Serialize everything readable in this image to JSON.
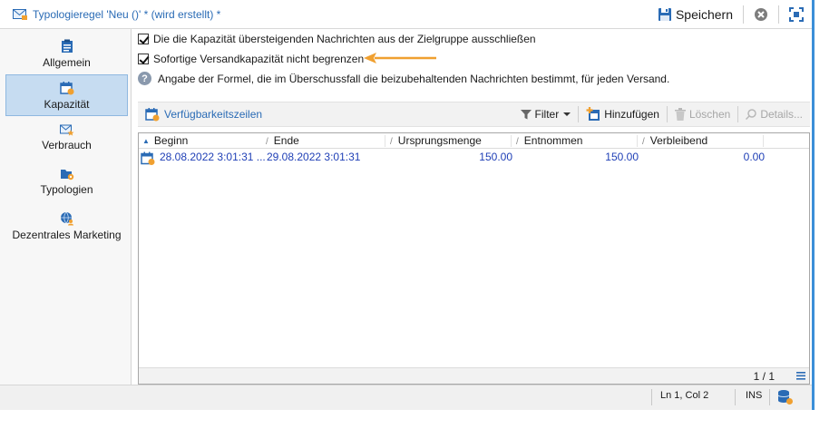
{
  "window": {
    "title": "Typologieregel 'Neu ()' * (wird erstellt) *",
    "save_label": "Speichern"
  },
  "sidebar": {
    "items": [
      {
        "label": "Allgemein",
        "icon": "clipboard-icon",
        "active": false
      },
      {
        "label": "Kapazität",
        "icon": "calendar-capacity-icon",
        "active": true
      },
      {
        "label": "Verbrauch",
        "icon": "envelope-star-icon",
        "active": false
      },
      {
        "label": "Typologien",
        "icon": "folder-gear-icon",
        "active": false
      },
      {
        "label": "Dezentrales Marketing",
        "icon": "globe-people-icon",
        "active": false
      }
    ]
  },
  "main": {
    "option_exclude": "Die die Kapazität übersteigenden Nachrichten aus der Zielgruppe ausschließen",
    "option_unlimited": "Sofortige Versandkapazität nicht begrenzen",
    "info_text": "Angabe der Formel, die im Überschussfall die beizubehaltenden Nachrichten bestimmt, für jeden Versand.",
    "grid_title": "Verfügbarkeitszeilen",
    "toolbar": {
      "filter": "Filter",
      "add": "Hinzufügen",
      "delete": "Löschen",
      "details": "Details..."
    },
    "columns": [
      "Beginn",
      "Ende",
      "Ursprungsmenge",
      "Entnommen",
      "Verbleibend"
    ],
    "rows": [
      {
        "beginn": "28.08.2022 3:01:31 ...",
        "ende": "29.08.2022 3:01:31",
        "ursprungsmenge": "150.00",
        "entnommen": "150.00",
        "verbleibend": "0.00"
      }
    ],
    "pager": "1 / 1"
  },
  "status": {
    "position": "Ln 1, Col 2",
    "mode": "INS"
  },
  "colors": {
    "accent": "#2a6bb5",
    "active_bg": "#c6dcf1",
    "arrow": "#f0a030",
    "row_text": "#1f3fb6"
  }
}
